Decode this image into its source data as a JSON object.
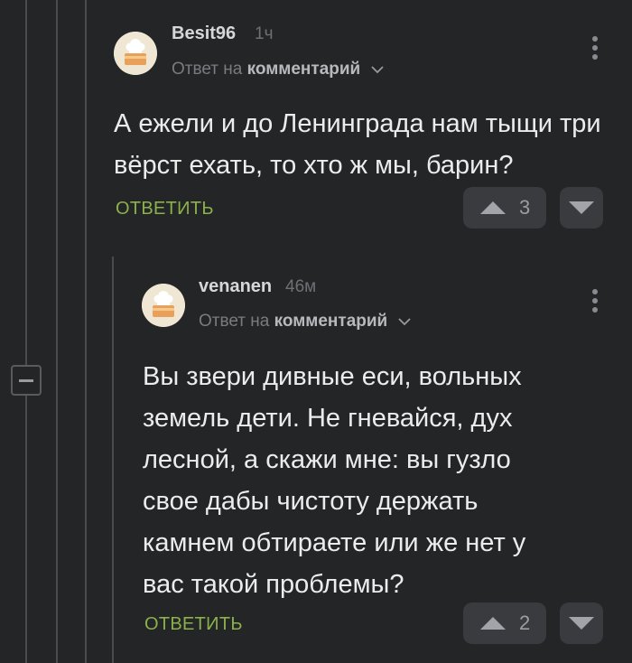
{
  "comments": [
    {
      "author": "Besit96",
      "time": "1ч",
      "reply_prefix": "Ответ на",
      "reply_target": "комментарий",
      "text": "А ежели и до Ленинграда нам тыщи три вёрст ехать, то хто ж мы, барин?",
      "reply_label": "ОТВЕТИТЬ",
      "votes": "3",
      "avatar_icon": "chef-cake-avatar",
      "menu_icon": "more-vertical-icon"
    },
    {
      "author": "venanen",
      "time": "46м",
      "reply_prefix": "Ответ на",
      "reply_target": "комментарий",
      "text": "Вы звери дивные еси, вольных земель дети. Не гневайся, дух лесной, а скажи мне: вы гузло свое дабы чистоту держать камнем обтираете или же нет у вас такой проблемы?",
      "reply_label": "ОТВЕТИТЬ",
      "votes": "2",
      "avatar_icon": "chef-cake-avatar",
      "menu_icon": "more-vertical-icon"
    }
  ],
  "colors": {
    "background": "#242527",
    "reply_green": "#8bb14b",
    "vote_bg": "#3a3b3f"
  }
}
